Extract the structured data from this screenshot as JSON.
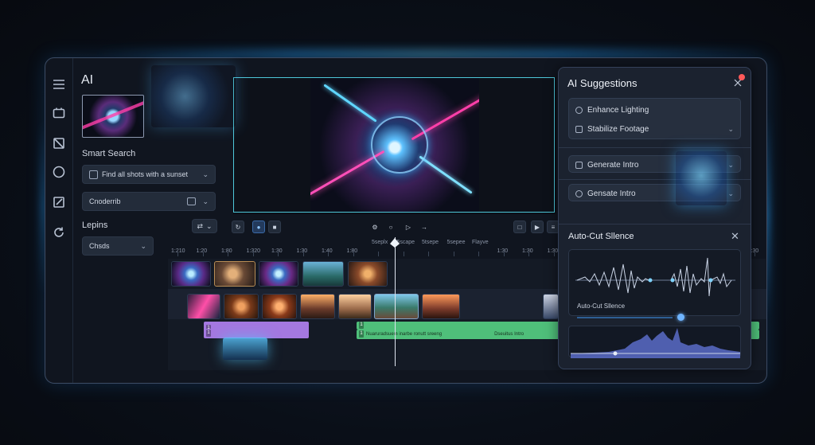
{
  "left": {
    "title": "AI",
    "smart_search_label": "Smart Search",
    "search_value": "Find all shots with a sunset",
    "second_field_value": "Cnoderrib",
    "layers_label": "Lepins",
    "layers_select": "Chsds"
  },
  "ruler": {
    "labels": [
      "1:210",
      "1:20",
      "1:80",
      "1:320",
      "1:30",
      "1:30",
      "1:40",
      "1:80",
      "5seplx",
      "5scape",
      "5tsepe",
      "5sepee",
      "Flayve",
      "1:30",
      "1:30",
      "1:30",
      "1:30",
      "1:30",
      "1:30",
      "1:30",
      "1:30",
      "1:30",
      "1:30",
      "1:30"
    ]
  },
  "audio": {
    "purple_top": "1",
    "purple_bottom": "1",
    "green_top_label": "1",
    "green_bottom_label": "1",
    "green_bottom_text": "Nuaruradsuem inarbe ronutt sreeng",
    "green_bottom_text2": "Dseuitus Intro"
  },
  "ai_suggestions": {
    "title": "AI Suggestions",
    "items": [
      {
        "label": "Enhance Lighting"
      },
      {
        "label": "Stabilize Footage"
      },
      {
        "label": "Generate Intro"
      },
      {
        "label": "Gensate Intro"
      }
    ],
    "auto_cut_title": "Auto-Cut Sllence",
    "auto_cut_label": "Auto-Cut Sllence"
  },
  "colors": {
    "accent": "#4ec7d9",
    "purple_track": "#a478e0",
    "green_track": "#4fbf7a",
    "panel": "#1b222f"
  },
  "icons": [
    "menu-icon",
    "folder-icon",
    "crop-icon",
    "circle-icon",
    "edit-icon",
    "refresh-icon",
    "settings-gear-icon",
    "chevron-down-icon",
    "play-icon",
    "close-icon",
    "notification-icon"
  ]
}
